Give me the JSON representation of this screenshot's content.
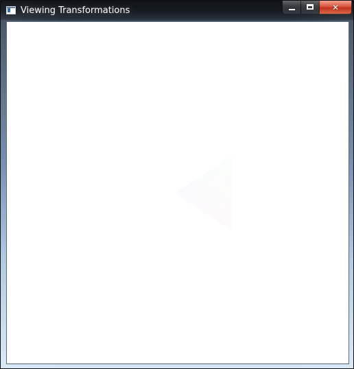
{
  "window": {
    "title": "Viewing Transformations",
    "icons": {
      "app": "app-icon",
      "minimize": "minimize-icon",
      "maximize": "maximize-icon",
      "close": "close-icon"
    }
  },
  "canvas": {
    "background": "#ffffff",
    "triangle": {
      "vertex_colors": [
        "#00cc00",
        "#ff0000",
        "#0000ff"
      ]
    }
  }
}
